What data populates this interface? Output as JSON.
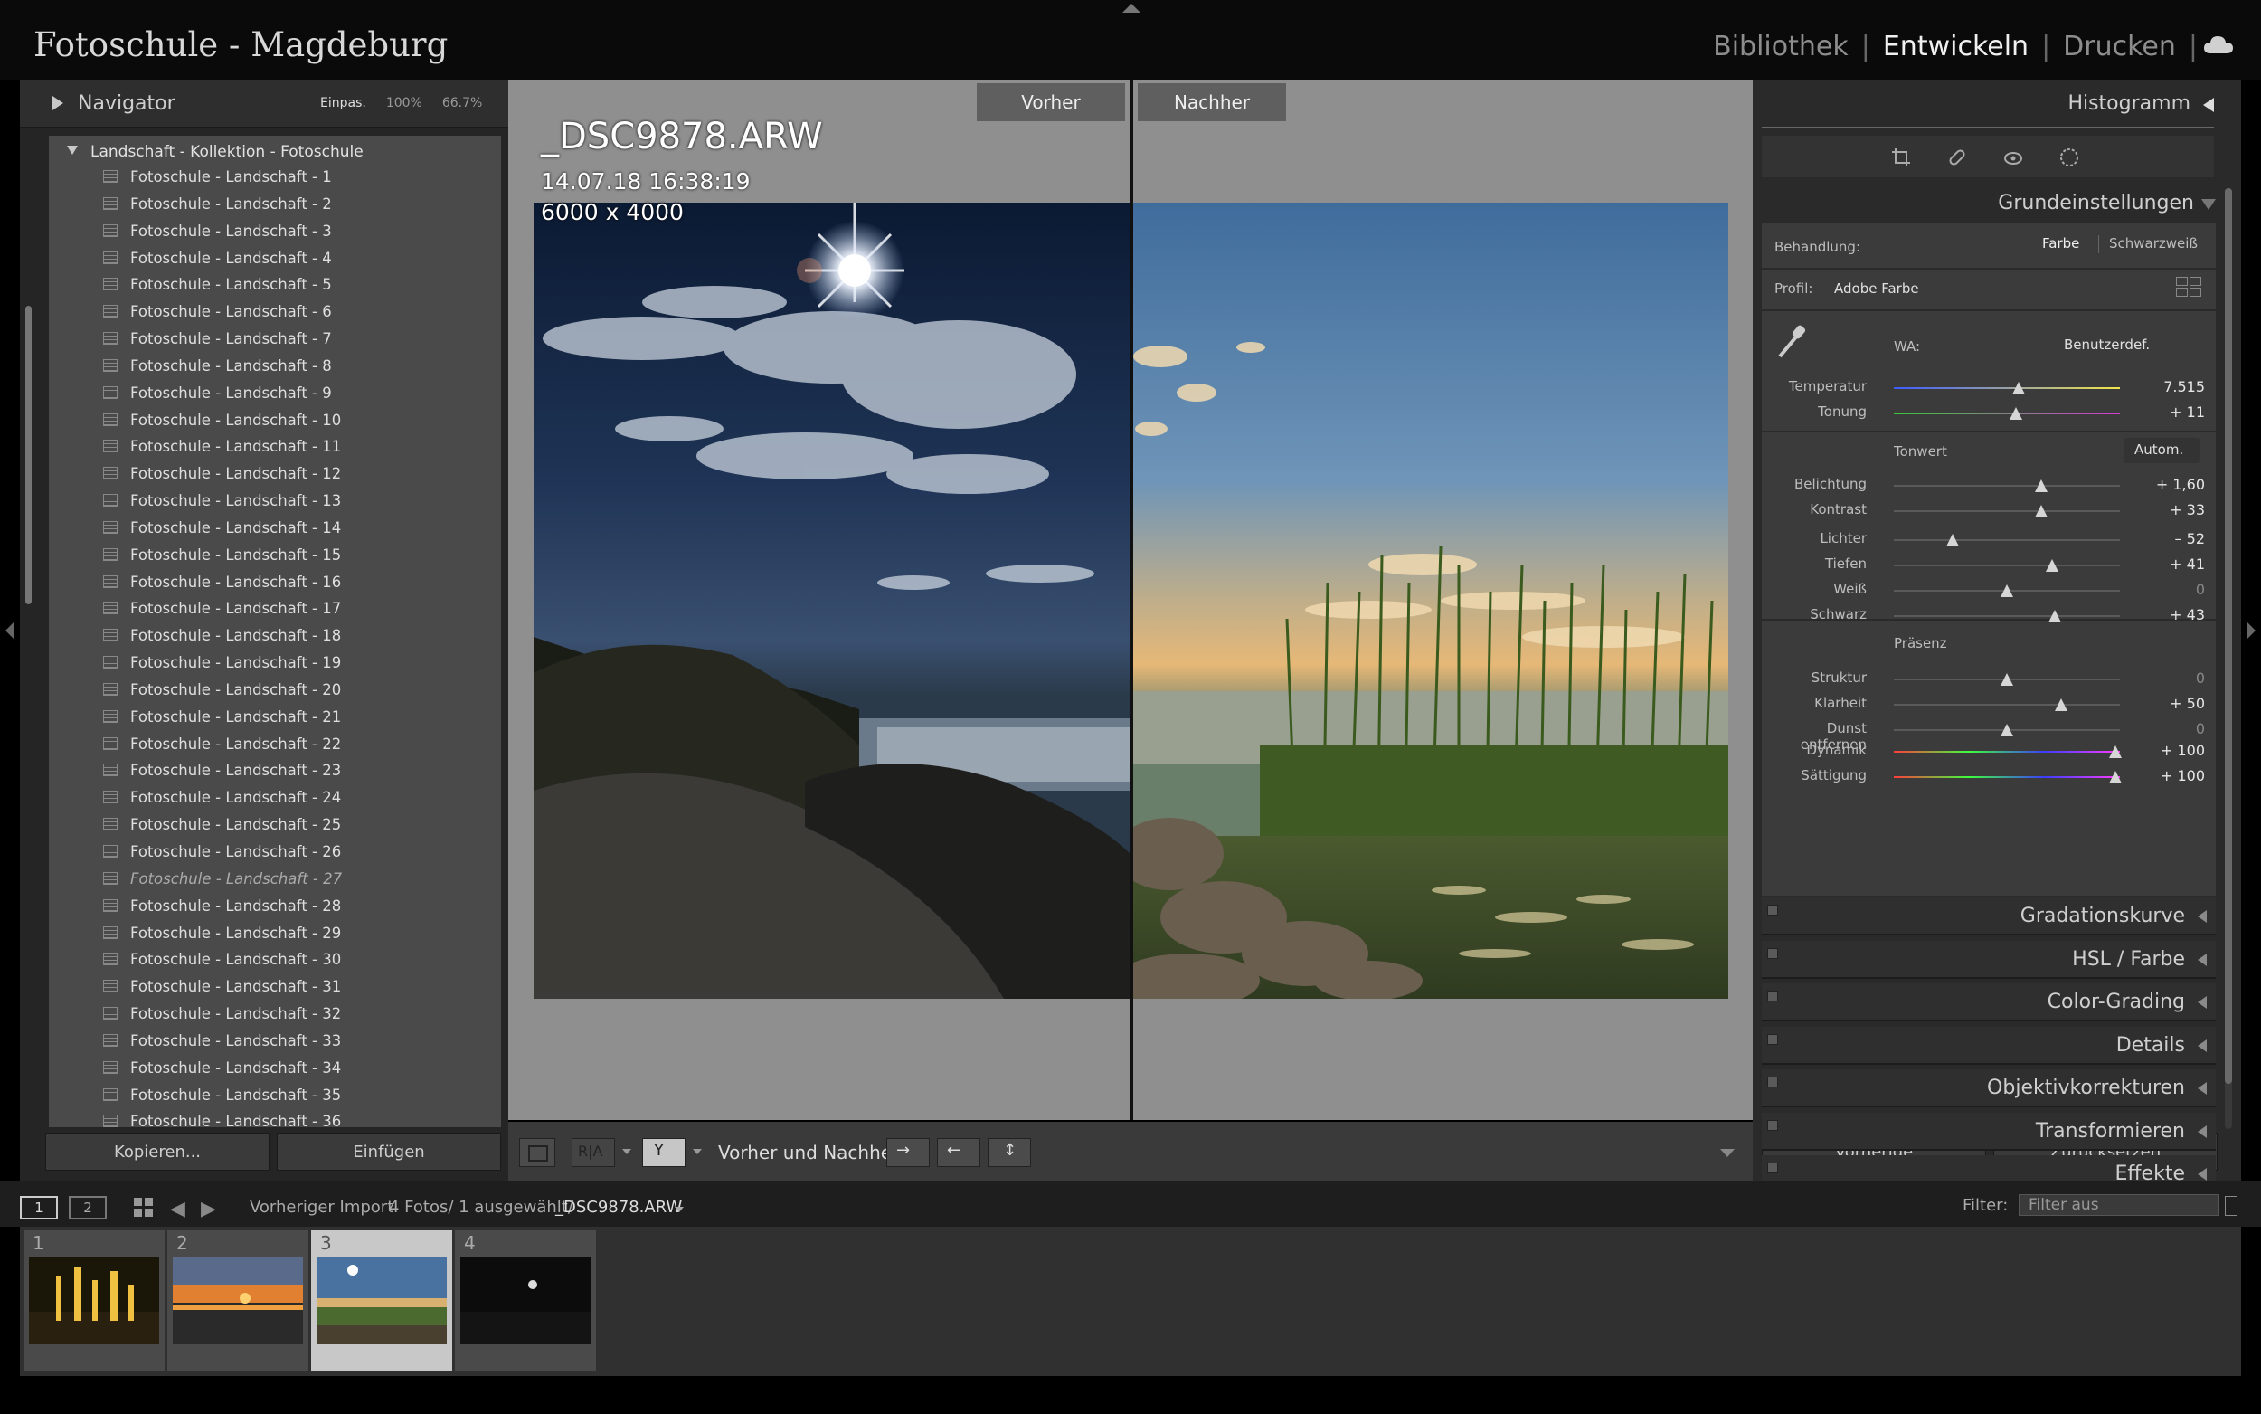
{
  "app": {
    "title": "Fotoschule - Magdeburg",
    "modules": [
      "Bibliothek",
      "Entwickeln",
      "Drucken"
    ],
    "active_module": "Entwickeln"
  },
  "left": {
    "navigator_title": "Navigator",
    "zoom_options": [
      "Einpas.",
      "100%",
      "66.7%"
    ],
    "collection_title": "Landschaft - Kollektion - Fotoschule",
    "collections": [
      "Fotoschule - Landschaft - 1",
      "Fotoschule - Landschaft - 2",
      "Fotoschule - Landschaft - 3",
      "Fotoschule - Landschaft - 4",
      "Fotoschule - Landschaft - 5",
      "Fotoschule - Landschaft - 6",
      "Fotoschule - Landschaft - 7",
      "Fotoschule - Landschaft - 8",
      "Fotoschule - Landschaft - 9",
      "Fotoschule - Landschaft - 10",
      "Fotoschule - Landschaft - 11",
      "Fotoschule - Landschaft - 12",
      "Fotoschule - Landschaft - 13",
      "Fotoschule - Landschaft - 14",
      "Fotoschule - Landschaft - 15",
      "Fotoschule - Landschaft - 16",
      "Fotoschule - Landschaft - 17",
      "Fotoschule - Landschaft - 18",
      "Fotoschule - Landschaft - 19",
      "Fotoschule - Landschaft - 20",
      "Fotoschule - Landschaft - 21",
      "Fotoschule - Landschaft - 22",
      "Fotoschule - Landschaft - 23",
      "Fotoschule - Landschaft - 24",
      "Fotoschule - Landschaft - 25",
      "Fotoschule - Landschaft - 26",
      "Fotoschule - Landschaft - 27",
      "Fotoschule - Landschaft - 28",
      "Fotoschule - Landschaft - 29",
      "Fotoschule - Landschaft - 30",
      "Fotoschule - Landschaft - 31",
      "Fotoschule - Landschaft - 32",
      "Fotoschule - Landschaft - 33",
      "Fotoschule - Landschaft - 34",
      "Fotoschule - Landschaft - 35",
      "Fotoschule - Landschaft - 36"
    ],
    "dimmed_collection": "Fotoschule - Landschaft - 27",
    "copy_button": "Kopieren...",
    "paste_button": "Einfügen"
  },
  "center": {
    "before_label": "Vorher",
    "after_label": "Nachher",
    "filename": "_DSC9878.ARW",
    "datetime": "14.07.18 16:38:19",
    "dimensions": "6000 x 4000",
    "toolbar_label": "Vorher und Nachher:"
  },
  "right": {
    "histogram_title": "Histogramm",
    "basic_title": "Grundeinstellungen",
    "treatment_label": "Behandlung:",
    "treatment_color": "Farbe",
    "treatment_bw": "Schwarzweiß",
    "profile_label": "Profil:",
    "profile_value": "Adobe Farbe",
    "wb_label": "WA:",
    "wb_value": "Benutzerdef.",
    "tone_title": "Tonwert",
    "auto_button": "Autom.",
    "presence_title": "Präsenz",
    "sliders": {
      "temperature": {
        "label": "Temperatur",
        "value": "7.515",
        "position": 0.55
      },
      "tint": {
        "label": "Tonung",
        "value": "+ 11",
        "position": 0.54
      },
      "exposure": {
        "label": "Belichtung",
        "value": "+ 1,60",
        "position": 0.65
      },
      "contrast": {
        "label": "Kontrast",
        "value": "+ 33",
        "position": 0.65
      },
      "highlights": {
        "label": "Lichter",
        "value": "– 52",
        "position": 0.26
      },
      "shadows": {
        "label": "Tiefen",
        "value": "+ 41",
        "position": 0.7
      },
      "whites": {
        "label": "Weiß",
        "value": "0",
        "position": 0.5
      },
      "blacks": {
        "label": "Schwarz",
        "value": "+ 43",
        "position": 0.71
      },
      "texture": {
        "label": "Struktur",
        "value": "0",
        "position": 0.5
      },
      "clarity": {
        "label": "Klarheit",
        "value": "+ 50",
        "position": 0.74
      },
      "dehaze": {
        "label": "Dunst entfernen",
        "value": "0",
        "position": 0.5
      },
      "vibrance": {
        "label": "Dynamik",
        "value": "+ 100",
        "position": 0.98
      },
      "saturation": {
        "label": "Sättigung",
        "value": "+ 100",
        "position": 0.98
      }
    },
    "sections": [
      "Gradationskurve",
      "HSL / Farbe",
      "Color-Grading",
      "Details",
      "Objektivkorrekturen",
      "Transformieren",
      "Effekte"
    ],
    "previous_button": "Vorherige",
    "reset_button": "Zurücksetzen"
  },
  "filmstrip": {
    "page1": "1",
    "page2": "2",
    "source": "Vorheriger Import",
    "info": "4 Fotos/ 1 ausgewählt/",
    "current_file": "_DSC9878.ARW",
    "filter_label": "Filter:",
    "filter_value": "Filter aus",
    "thumbs": [
      "1",
      "2",
      "3",
      "4"
    ]
  },
  "colors": {
    "temperature_gradient": [
      "#3c5cff",
      "#f2e64a"
    ],
    "tint_gradient": [
      "#39c839",
      "#d43cd4"
    ],
    "saturation_gradient": [
      "#ff3c3c",
      "#3cff3c",
      "#3c3cff",
      "#ff3cff"
    ]
  }
}
